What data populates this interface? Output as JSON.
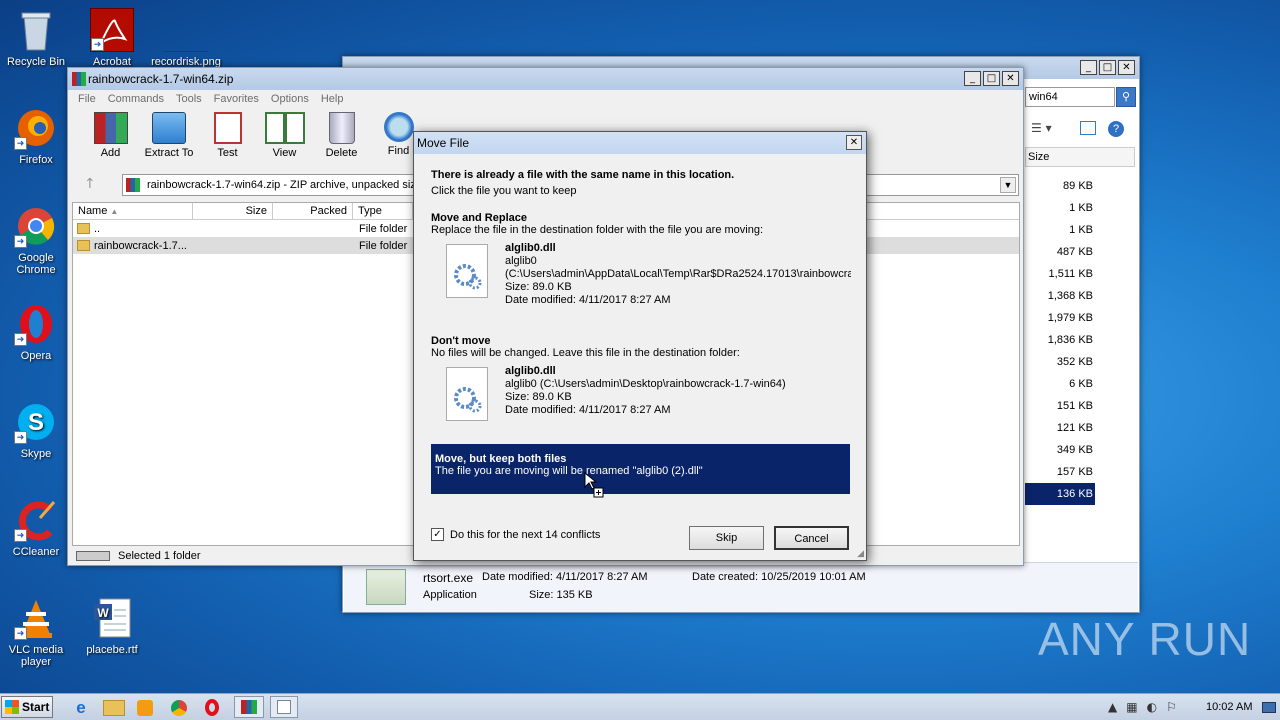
{
  "desktop": {
    "icons": [
      {
        "label": "Recycle Bin"
      },
      {
        "label": "Acrobat"
      },
      {
        "label": "recordrisk.png"
      },
      {
        "label": "Firefox"
      },
      {
        "label": "Google Chrome"
      },
      {
        "label": "Opera"
      },
      {
        "label": "Skype"
      },
      {
        "label": "CCleaner"
      },
      {
        "label": "VLC media player"
      },
      {
        "label": "placebe.rtf"
      }
    ]
  },
  "explorer": {
    "search_value": "win64",
    "size_header": "Size",
    "sizes": [
      "89 KB",
      "1 KB",
      "1 KB",
      "487 KB",
      "1,511 KB",
      "1,368 KB",
      "1,979 KB",
      "1,836 KB",
      "352 KB",
      "6 KB",
      "151 KB",
      "121 KB",
      "349 KB",
      "157 KB",
      "136 KB"
    ],
    "details": {
      "filename": "rtsort.exe",
      "modified": "Date modified: 4/11/2017 8:27 AM",
      "created": "Date created: 10/25/2019 10:01 AM",
      "type": "Application",
      "size": "Size: 135 KB"
    }
  },
  "winrar": {
    "title": "rainbowcrack-1.7-win64.zip",
    "menu": [
      "File",
      "Commands",
      "Tools",
      "Favorites",
      "Options",
      "Help"
    ],
    "toolbar": [
      "Add",
      "Extract To",
      "Test",
      "View",
      "Delete",
      "Find"
    ],
    "address": "rainbowcrack-1.7-win64.zip - ZIP archive, unpacked siz",
    "columns": [
      "Name",
      "Size",
      "Packed",
      "Type"
    ],
    "rows": [
      {
        "name": "..",
        "type": "File folder"
      },
      {
        "name": "rainbowcrack-1.7...",
        "type": "File folder"
      }
    ],
    "status": "Selected 1 folder"
  },
  "dialog": {
    "title": "Move File",
    "heading": "There is already a file with the same name in this location.",
    "subheading": "Click the file you want to keep",
    "replace": {
      "title": "Move and Replace",
      "desc": "Replace the file in the destination folder with the file you are moving:",
      "filename": "alglib0.dll",
      "name": "alglib0",
      "path": "(C:\\Users\\admin\\AppData\\Local\\Temp\\Rar$DRa2524.17013\\rainbowcra",
      "size": "Size: 89.0 KB",
      "modified": "Date modified: 4/11/2017 8:27 AM"
    },
    "dontmove": {
      "title": "Don't move",
      "desc": "No files will be changed. Leave this file in the destination folder:",
      "filename": "alglib0.dll",
      "path": "alglib0 (C:\\Users\\admin\\Desktop\\rainbowcrack-1.7-win64)",
      "size": "Size: 89.0 KB",
      "modified": "Date modified: 4/11/2017 8:27 AM"
    },
    "keepboth": {
      "title": "Move, but keep both files",
      "desc": "The file you are moving will be renamed \"alglib0 (2).dll\""
    },
    "checkbox_label": "Do this for the next 14 conflicts",
    "skip": "Skip",
    "cancel": "Cancel"
  },
  "taskbar": {
    "start": "Start",
    "time": "10:02 AM"
  },
  "watermark": "ANY RUN"
}
